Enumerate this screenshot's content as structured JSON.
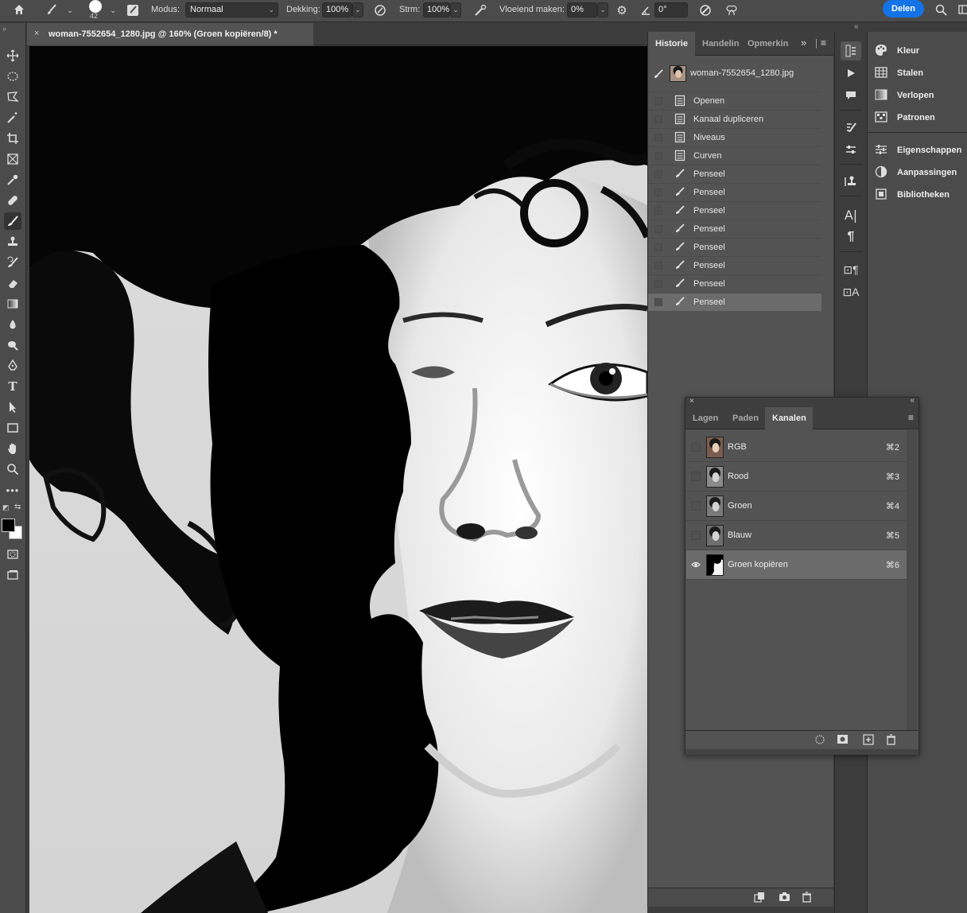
{
  "options_bar": {
    "brush_size": "42",
    "mode_label": "Modus:",
    "mode_value": "Normaal",
    "opacity_label": "Dekking:",
    "opacity_value": "100%",
    "flow_label": "Strm:",
    "flow_value": "100%",
    "smoothing_label": "Vloeiend maken:",
    "smoothing_value": "0%",
    "angle_value": "0°",
    "share_label": "Delen"
  },
  "document": {
    "tab_title": "woman-7552654_1280.jpg @ 160% (Groen kopiëren/8) *",
    "close_glyph": "×"
  },
  "history_panel": {
    "tabs": [
      "Historie",
      "Handelin",
      "Opmerkin"
    ],
    "more_glyph": "»",
    "snapshot_label": "woman-7552654_1280.jpg",
    "items": [
      {
        "label": "Openen",
        "icon": "document-icon"
      },
      {
        "label": "Kanaal dupliceren",
        "icon": "document-icon"
      },
      {
        "label": "Niveaus",
        "icon": "document-icon"
      },
      {
        "label": "Curven",
        "icon": "document-icon"
      },
      {
        "label": "Penseel",
        "icon": "brush-icon"
      },
      {
        "label": "Penseel",
        "icon": "brush-icon"
      },
      {
        "label": "Penseel",
        "icon": "brush-icon"
      },
      {
        "label": "Penseel",
        "icon": "brush-icon"
      },
      {
        "label": "Penseel",
        "icon": "brush-icon"
      },
      {
        "label": "Penseel",
        "icon": "brush-icon"
      },
      {
        "label": "Penseel",
        "icon": "brush-icon"
      },
      {
        "label": "Penseel",
        "icon": "brush-icon"
      }
    ],
    "selected_index": 11
  },
  "right_dock": {
    "items": [
      {
        "label": "Kleur",
        "icon": "palette-icon"
      },
      {
        "label": "Stalen",
        "icon": "grid-icon"
      },
      {
        "label": "Verlopen",
        "icon": "gradient-icon"
      },
      {
        "label": "Patronen",
        "icon": "pattern-icon"
      },
      {
        "label": "Eigenschappen",
        "icon": "sliders-icon"
      },
      {
        "label": "Aanpassingen",
        "icon": "adjustments-icon"
      },
      {
        "label": "Bibliotheken",
        "icon": "library-icon"
      }
    ]
  },
  "channels_panel": {
    "tabs": [
      "Lagen",
      "Paden",
      "Kanalen"
    ],
    "active_tab": "Kanalen",
    "channels": [
      {
        "label": "RGB",
        "shortcut": "⌘2",
        "thumb_color": "#7a5d4e"
      },
      {
        "label": "Rood",
        "shortcut": "⌘3",
        "thumb_color": "#8a8a8a"
      },
      {
        "label": "Groen",
        "shortcut": "⌘4",
        "thumb_color": "#7a7a7a"
      },
      {
        "label": "Blauw",
        "shortcut": "⌘5",
        "thumb_color": "#6e6e6e"
      },
      {
        "label": "Groen kopiëren",
        "shortcut": "⌘6",
        "thumb_color": "#111111"
      }
    ],
    "selected_index": 4
  },
  "colors": {
    "foreground": "#000000",
    "background": "#ffffff",
    "accent": "#1473e6"
  }
}
